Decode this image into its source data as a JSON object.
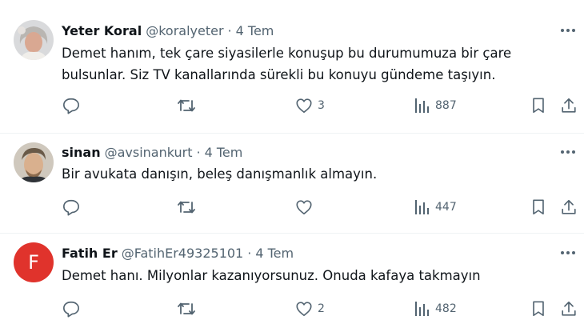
{
  "colors": {
    "text": "#0f1419",
    "secondary": "#536471",
    "separator": "#eff3f4",
    "letter_avatar": "#e0332c"
  },
  "tweets": [
    {
      "name": "Yeter Koral",
      "handle": "@koralyeter",
      "separator": "·",
      "date": "4 Tem",
      "avatar": "photo-avatar",
      "text_lines": [
        "Demet hanım, tek çare siyasilerle konuşup bu durumumuza bir çare",
        "bulsunlar. Siz TV kanallarında sürekli bu konuyu gündeme taşıyın."
      ],
      "likes": "3",
      "views": "887"
    },
    {
      "name": "sinan",
      "handle": "@avsinankurt",
      "separator": "·",
      "date": "4 Tem",
      "avatar": "photo-avatar",
      "text_lines": [
        "Bir avukata danışın, beleş danışmanlık almayın."
      ],
      "likes": "",
      "views": "447"
    },
    {
      "name": "Fatih Er",
      "handle": "@FatihEr49325101",
      "separator": "·",
      "date": "4 Tem",
      "avatar_letter": "F",
      "text_lines": [
        "Demet hanı. Milyonlar kazanıyorsunuz. Onuda kafaya takmayın"
      ],
      "likes": "2",
      "views": "482"
    }
  ]
}
